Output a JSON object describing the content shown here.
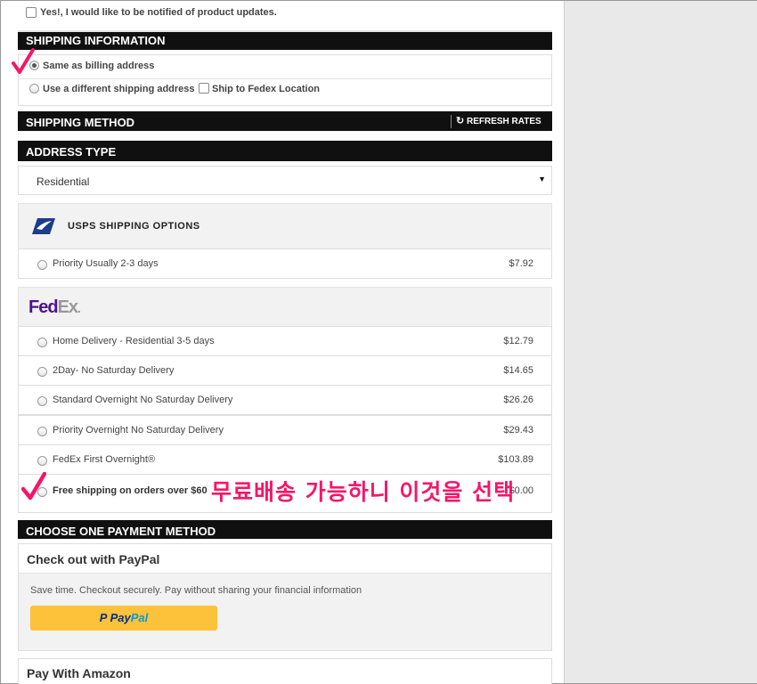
{
  "notify": {
    "label": "Yes!, I would like to be notified of product updates."
  },
  "shipping_info": {
    "title": "SHIPPING INFORMATION",
    "same_as_billing": "Same as billing address",
    "different_address": "Use a different shipping address",
    "fedex_location": "Ship to Fedex Location"
  },
  "shipping_method": {
    "title": "SHIPPING METHOD",
    "refresh_label": "REFRESH RATES"
  },
  "address_type": {
    "title": "ADDRESS TYPE",
    "selected": "Residential"
  },
  "usps": {
    "title": "USPS SHIPPING OPTIONS",
    "options": [
      {
        "label": "Priority Usually 2-3 days",
        "price": "$7.92"
      }
    ]
  },
  "fedex": {
    "logo_fed": "Fed",
    "logo_ex": "Ex",
    "options": [
      {
        "label": "Home Delivery - Residential 3-5 days",
        "price": "$12.79"
      },
      {
        "label": "2Day- No Saturday Delivery",
        "price": "$14.65"
      },
      {
        "label": "Standard Overnight No Saturday Delivery",
        "price": "$26.26"
      },
      {
        "label": "Priority Overnight No Saturday Delivery",
        "price": "$29.43"
      },
      {
        "label": "FedEx First Overnight®",
        "price": "$103.89"
      },
      {
        "label": "Free shipping on orders over $60",
        "price": "$0.00"
      }
    ]
  },
  "annotation": {
    "text": "무료배송 가능하니 이것을 선택"
  },
  "payment": {
    "title": "CHOOSE ONE PAYMENT METHOD",
    "paypal_title": "Check out with PayPal",
    "paypal_desc": "Save time. Checkout securely. Pay without sharing your financial information",
    "paypal_btn_pay": "Pay",
    "paypal_btn_pal": "Pal",
    "amazon_title": "Pay With Amazon"
  },
  "colors": {
    "accent_pink": "#f5166a",
    "paypal_yellow": "#fec13a",
    "fedex_purple": "#4d148c",
    "fedex_gray": "#999999"
  }
}
